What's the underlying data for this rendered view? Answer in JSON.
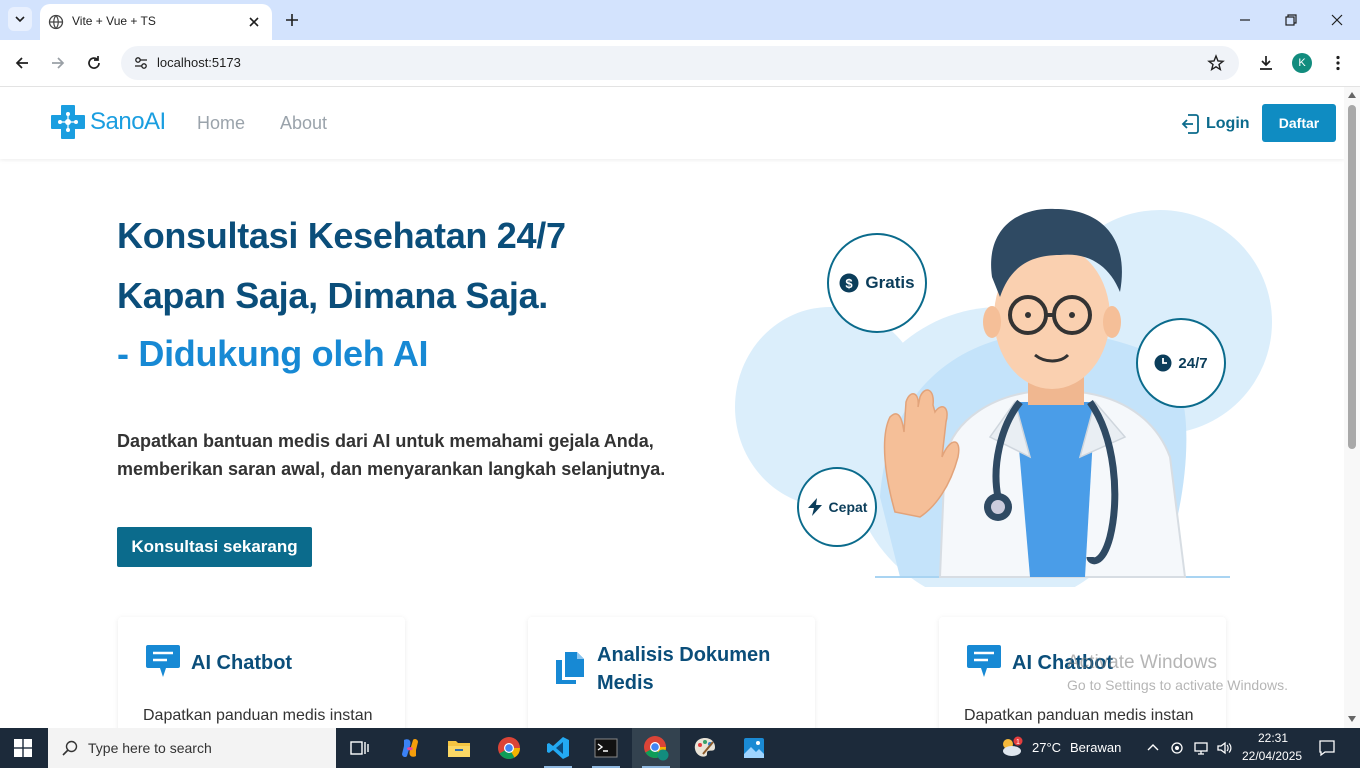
{
  "browser": {
    "tab_title": "Vite + Vue + TS",
    "url": "localhost:5173",
    "profile_initial": "K"
  },
  "site": {
    "logo_text": "SanoAI",
    "nav": [
      "Home",
      "About"
    ],
    "login_label": "Login",
    "register_label": "Daftar"
  },
  "hero": {
    "title_line1": "Konsultasi Kesehatan 24/7",
    "title_line2": "Kapan Saja, Dimana Saja.",
    "title_line3": "- Didukung oleh AI",
    "desc_line1": "Dapatkan bantuan medis dari AI untuk memahami gejala Anda,",
    "desc_line2": "memberikan saran awal, dan menyarankan langkah selanjutnya.",
    "cta_label": "Konsultasi sekarang"
  },
  "badges": {
    "free": "Gratis",
    "always": "24/7",
    "fast": "Cepat"
  },
  "features": [
    {
      "title": "AI Chatbot",
      "desc": "Dapatkan panduan medis instan",
      "icon": "chat-icon"
    },
    {
      "title_line1": "Analisis Dokumen",
      "title_line2": "Medis",
      "icon": "documents-icon"
    },
    {
      "title": "AI Chatbot",
      "desc": "Dapatkan panduan medis instan",
      "icon": "chat-icon"
    }
  ],
  "watermark": {
    "line1": "Activate Windows",
    "line2": "Go to Settings to activate Windows."
  },
  "taskbar": {
    "search_placeholder": "Type here to search",
    "weather_temp": "27°C",
    "weather_text": "Berawan",
    "weather_alert": "1",
    "time": "22:31",
    "date": "22/04/2025"
  },
  "colors": {
    "brand": "#1a9ee0",
    "primary_dark": "#0b6b8c",
    "heading": "#0b4e7a",
    "accent": "#1789d4"
  }
}
